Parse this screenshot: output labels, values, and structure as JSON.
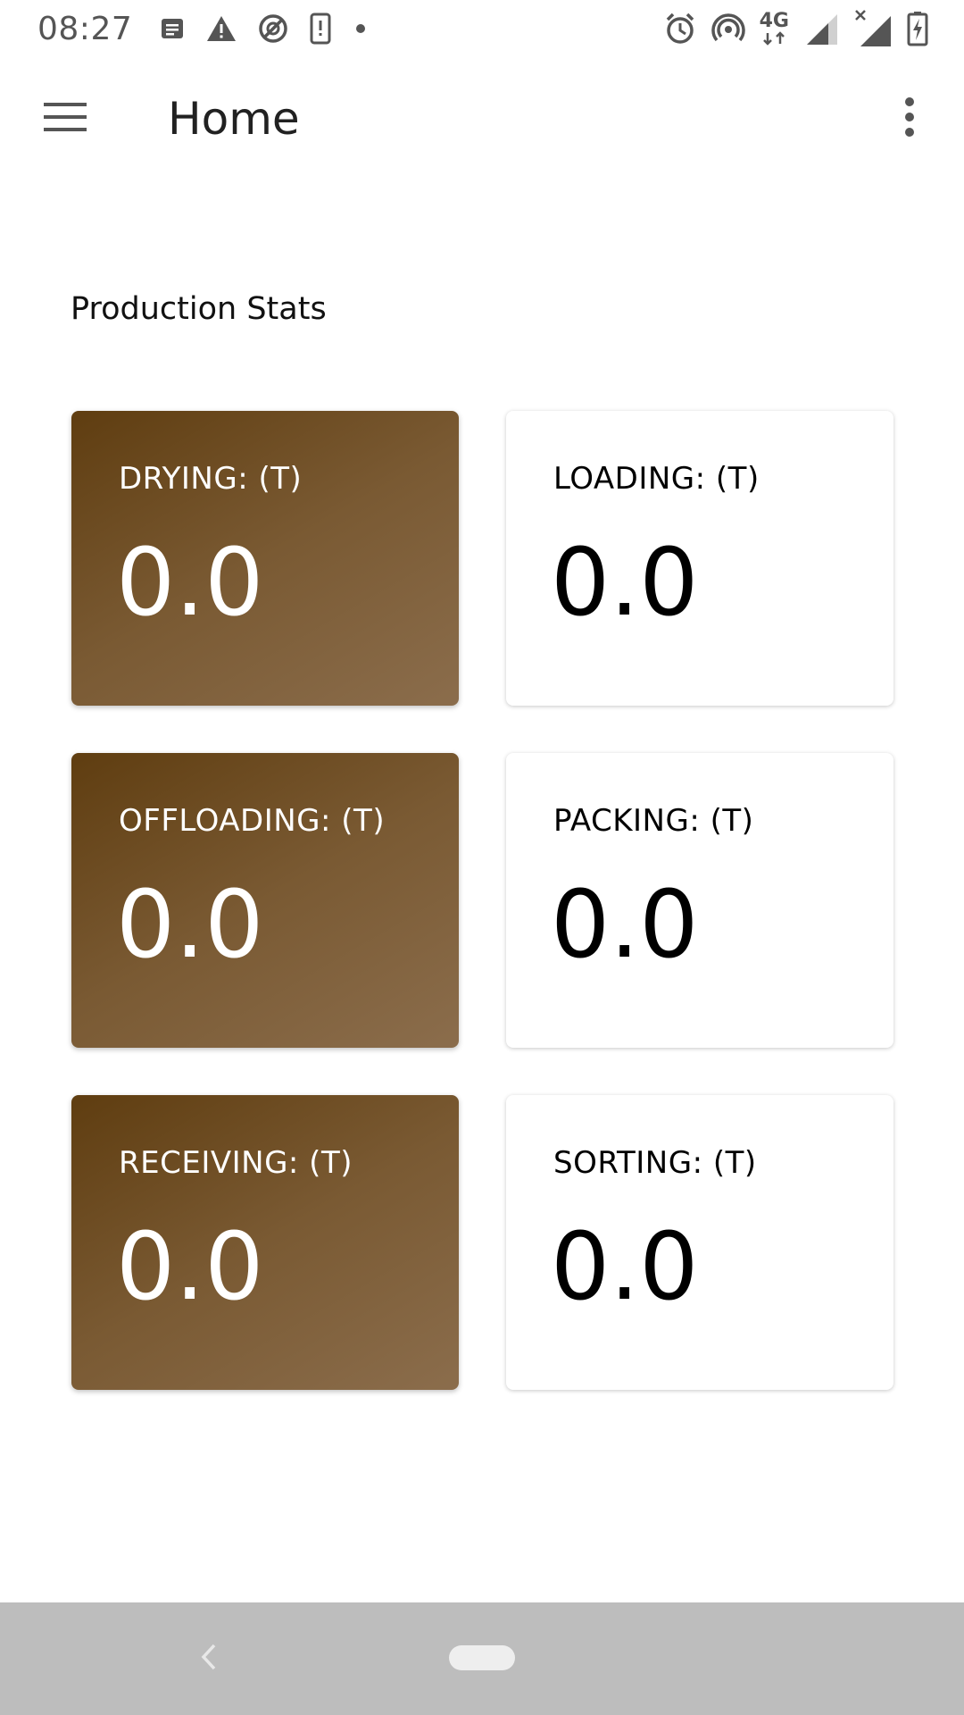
{
  "status_bar": {
    "time": "08:27",
    "left_icons": [
      "message-icon",
      "warning-icon",
      "sync-disabled-icon",
      "phone-alert-icon",
      "dot-icon"
    ],
    "right_icons": [
      "alarm-icon",
      "hotspot-icon",
      "network-4g-icon",
      "signal-icon",
      "signal-no-service-icon",
      "battery-charging-icon"
    ],
    "network_label": "4G"
  },
  "app_bar": {
    "title": "Home",
    "menu_icon": "menu-icon",
    "overflow_icon": "more-vert-icon"
  },
  "main": {
    "section_title": "Production Stats",
    "cards": [
      {
        "label": "DRYING: (T)",
        "value": "0.0",
        "style": "brown"
      },
      {
        "label": "LOADING: (T)",
        "value": "0.0",
        "style": "white"
      },
      {
        "label": "OFFLOADING: (T)",
        "value": "0.0",
        "style": "brown"
      },
      {
        "label": "PACKING: (T)",
        "value": "0.0",
        "style": "white"
      },
      {
        "label": "RECEIVING: (T)",
        "value": "0.0",
        "style": "brown"
      },
      {
        "label": "SORTING: (T)",
        "value": "0.0",
        "style": "white"
      }
    ]
  },
  "nav_bar": {
    "back_icon": "back-chevron-icon",
    "home_icon": "home-pill-icon"
  },
  "colors": {
    "brown_card_start": "#5f3d10",
    "brown_card_end": "#8b6d4c",
    "nav_bar": "#bdbdbd",
    "text_primary": "#212121"
  }
}
